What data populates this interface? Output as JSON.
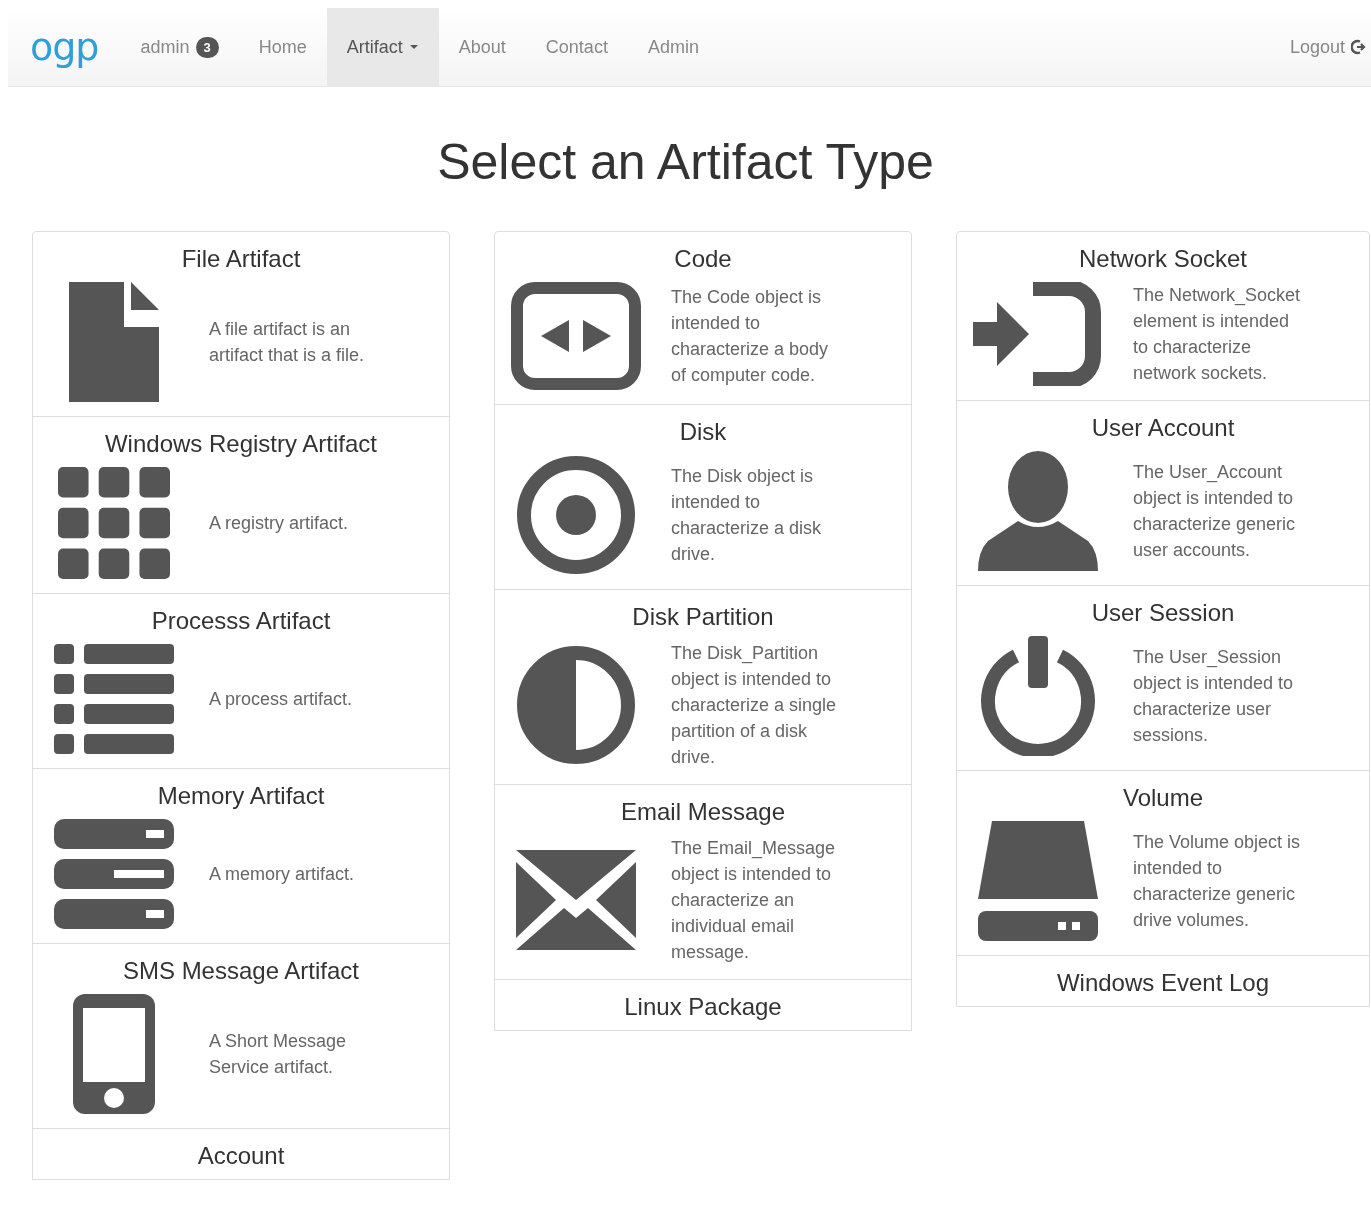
{
  "navbar": {
    "logo": "ogp",
    "user": {
      "label": "admin",
      "badge": "3"
    },
    "items": [
      {
        "label": "Home",
        "selected": false,
        "kind": "link"
      },
      {
        "label": "Artifact",
        "selected": true,
        "kind": "dropdown"
      },
      {
        "label": "About",
        "selected": false,
        "kind": "link"
      },
      {
        "label": "Contact",
        "selected": false,
        "kind": "link"
      },
      {
        "label": "Admin",
        "selected": false,
        "kind": "link"
      }
    ],
    "logout": "Logout"
  },
  "heading": "Select an Artifact Type",
  "columns": [
    {
      "cards": [
        {
          "title": "File Artifact",
          "kind": "file",
          "description": "A file artifact is an artifact that is a file."
        },
        {
          "title": "Windows Registry Artifact",
          "kind": "grid",
          "description": "A registry artifact."
        },
        {
          "title": "Processs Artifact",
          "kind": "list",
          "description": "A process artifact."
        },
        {
          "title": "Memory Artifact",
          "kind": "servers",
          "description": "A memory artifact."
        },
        {
          "title": "SMS Message Artifact",
          "kind": "mobile",
          "description": "A Short Message Service artifact."
        },
        {
          "title": "Account"
        }
      ]
    },
    {
      "cards": [
        {
          "title": "Code",
          "kind": "code",
          "description": "The Code object is intended to characterize a body of computer code."
        },
        {
          "title": "Disk",
          "kind": "target",
          "description": "The Disk object is intended to characterize a disk drive."
        },
        {
          "title": "Disk Partition",
          "kind": "half",
          "description": "The Disk_Partition object is intended to characterize a single partition of a disk drive."
        },
        {
          "title": "Email Message",
          "kind": "envelope",
          "description": "The Email_Message object is intended to characterize an individual email message."
        },
        {
          "title": "Linux Package"
        }
      ]
    },
    {
      "cards": [
        {
          "title": "Network Socket",
          "kind": "login",
          "description": "The Network_Socket element is intended to characterize network sockets."
        },
        {
          "title": "User Account",
          "kind": "user",
          "description": "The User_Account object is intended to characterize generic user accounts."
        },
        {
          "title": "User Session",
          "kind": "power",
          "description": "The User_Session object is intended to characterize user sessions."
        },
        {
          "title": "Volume",
          "kind": "drive",
          "description": "The Volume object is intended to characterize generic drive volumes."
        },
        {
          "title": "Windows Event Log"
        }
      ]
    }
  ]
}
